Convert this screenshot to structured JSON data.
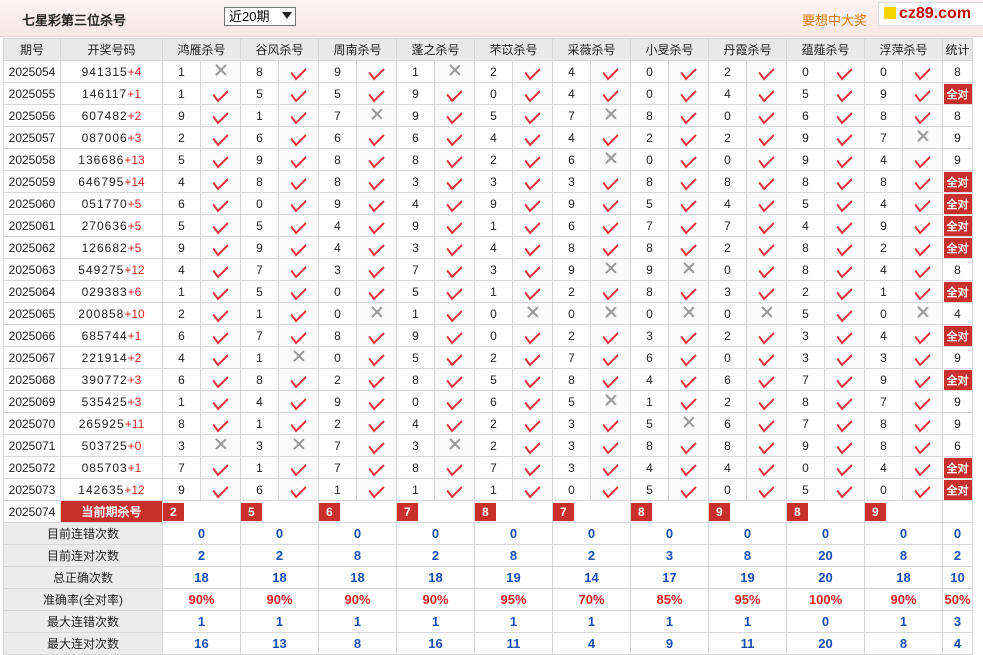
{
  "header": {
    "title": "七星彩第三位杀号",
    "period_select": "近20期",
    "promo": "要想中大奖",
    "logo": "cz89.com"
  },
  "columns": [
    "期号",
    "开奖号码",
    "鸿雁杀号",
    "谷风杀号",
    "周南杀号",
    "蓬之杀号",
    "芣苡杀号",
    "采薇杀号",
    "小旻杀号",
    "丹霞杀号",
    "蕴薤杀号",
    "浮萍杀号",
    "统计"
  ],
  "rows": [
    {
      "p": "2025054",
      "num": "941315",
      "d": "+4",
      "k": [
        [
          "1",
          0
        ],
        [
          "8",
          1
        ],
        [
          "9",
          1
        ],
        [
          "1",
          0
        ],
        [
          "2",
          1
        ],
        [
          "4",
          1
        ],
        [
          "0",
          1
        ],
        [
          "2",
          1
        ],
        [
          "0",
          1
        ],
        [
          "0",
          1
        ]
      ],
      "s": "8"
    },
    {
      "p": "2025055",
      "num": "146117",
      "d": "+1",
      "k": [
        [
          "1",
          1
        ],
        [
          "5",
          1
        ],
        [
          "5",
          1
        ],
        [
          "9",
          1
        ],
        [
          "0",
          1
        ],
        [
          "4",
          1
        ],
        [
          "0",
          1
        ],
        [
          "4",
          1
        ],
        [
          "5",
          1
        ],
        [
          "9",
          1
        ]
      ],
      "s": "全对"
    },
    {
      "p": "2025056",
      "num": "607482",
      "d": "+2",
      "k": [
        [
          "9",
          1
        ],
        [
          "1",
          1
        ],
        [
          "7",
          0
        ],
        [
          "9",
          1
        ],
        [
          "5",
          1
        ],
        [
          "7",
          0
        ],
        [
          "8",
          1
        ],
        [
          "0",
          1
        ],
        [
          "6",
          1
        ],
        [
          "8",
          1
        ]
      ],
      "s": "8"
    },
    {
      "p": "2025057",
      "num": "087006",
      "d": "+3",
      "k": [
        [
          "2",
          1
        ],
        [
          "6",
          1
        ],
        [
          "6",
          1
        ],
        [
          "6",
          1
        ],
        [
          "4",
          1
        ],
        [
          "4",
          1
        ],
        [
          "2",
          1
        ],
        [
          "2",
          1
        ],
        [
          "9",
          1
        ],
        [
          "7",
          0
        ]
      ],
      "s": "9"
    },
    {
      "p": "2025058",
      "num": "136686",
      "d": "+13",
      "k": [
        [
          "5",
          1
        ],
        [
          "9",
          1
        ],
        [
          "8",
          1
        ],
        [
          "8",
          1
        ],
        [
          "2",
          1
        ],
        [
          "6",
          0
        ],
        [
          "0",
          1
        ],
        [
          "0",
          1
        ],
        [
          "9",
          1
        ],
        [
          "4",
          1
        ]
      ],
      "s": "9"
    },
    {
      "p": "2025059",
      "num": "646795",
      "d": "+14",
      "k": [
        [
          "4",
          1
        ],
        [
          "8",
          1
        ],
        [
          "8",
          1
        ],
        [
          "3",
          1
        ],
        [
          "3",
          1
        ],
        [
          "3",
          1
        ],
        [
          "8",
          1
        ],
        [
          "8",
          1
        ],
        [
          "8",
          1
        ],
        [
          "8",
          1
        ]
      ],
      "s": "全对"
    },
    {
      "p": "2025060",
      "num": "051770",
      "d": "+5",
      "k": [
        [
          "6",
          1
        ],
        [
          "0",
          1
        ],
        [
          "9",
          1
        ],
        [
          "4",
          1
        ],
        [
          "9",
          1
        ],
        [
          "9",
          1
        ],
        [
          "5",
          1
        ],
        [
          "4",
          1
        ],
        [
          "5",
          1
        ],
        [
          "4",
          1
        ]
      ],
      "s": "全对"
    },
    {
      "p": "2025061",
      "num": "270636",
      "d": "+5",
      "k": [
        [
          "5",
          1
        ],
        [
          "5",
          1
        ],
        [
          "4",
          1
        ],
        [
          "9",
          1
        ],
        [
          "1",
          1
        ],
        [
          "6",
          1
        ],
        [
          "7",
          1
        ],
        [
          "7",
          1
        ],
        [
          "4",
          1
        ],
        [
          "9",
          1
        ]
      ],
      "s": "全对"
    },
    {
      "p": "2025062",
      "num": "126682",
      "d": "+5",
      "k": [
        [
          "9",
          1
        ],
        [
          "9",
          1
        ],
        [
          "4",
          1
        ],
        [
          "3",
          1
        ],
        [
          "4",
          1
        ],
        [
          "8",
          1
        ],
        [
          "8",
          1
        ],
        [
          "2",
          1
        ],
        [
          "8",
          1
        ],
        [
          "2",
          1
        ]
      ],
      "s": "全对"
    },
    {
      "p": "2025063",
      "num": "549275",
      "d": "+12",
      "k": [
        [
          "4",
          1
        ],
        [
          "7",
          1
        ],
        [
          "3",
          1
        ],
        [
          "7",
          1
        ],
        [
          "3",
          1
        ],
        [
          "9",
          0
        ],
        [
          "9",
          0
        ],
        [
          "0",
          1
        ],
        [
          "8",
          1
        ],
        [
          "4",
          1
        ]
      ],
      "s": "8"
    },
    {
      "p": "2025064",
      "num": "029383",
      "d": "+6",
      "k": [
        [
          "1",
          1
        ],
        [
          "5",
          1
        ],
        [
          "0",
          1
        ],
        [
          "5",
          1
        ],
        [
          "1",
          1
        ],
        [
          "2",
          1
        ],
        [
          "8",
          1
        ],
        [
          "3",
          1
        ],
        [
          "2",
          1
        ],
        [
          "1",
          1
        ]
      ],
      "s": "全对"
    },
    {
      "p": "2025065",
      "num": "200858",
      "d": "+10",
      "k": [
        [
          "2",
          1
        ],
        [
          "1",
          1
        ],
        [
          "0",
          0
        ],
        [
          "1",
          1
        ],
        [
          "0",
          0
        ],
        [
          "0",
          0
        ],
        [
          "0",
          0
        ],
        [
          "0",
          0
        ],
        [
          "5",
          1
        ],
        [
          "0",
          0
        ]
      ],
      "s": "4"
    },
    {
      "p": "2025066",
      "num": "685744",
      "d": "+1",
      "k": [
        [
          "6",
          1
        ],
        [
          "7",
          1
        ],
        [
          "8",
          1
        ],
        [
          "9",
          1
        ],
        [
          "0",
          1
        ],
        [
          "2",
          1
        ],
        [
          "3",
          1
        ],
        [
          "2",
          1
        ],
        [
          "3",
          1
        ],
        [
          "4",
          1
        ]
      ],
      "s": "全对"
    },
    {
      "p": "2025067",
      "num": "221914",
      "d": "+2",
      "k": [
        [
          "4",
          1
        ],
        [
          "1",
          0
        ],
        [
          "0",
          1
        ],
        [
          "5",
          1
        ],
        [
          "2",
          1
        ],
        [
          "7",
          1
        ],
        [
          "6",
          1
        ],
        [
          "0",
          1
        ],
        [
          "3",
          1
        ],
        [
          "3",
          1
        ]
      ],
      "s": "9"
    },
    {
      "p": "2025068",
      "num": "390772",
      "d": "+3",
      "k": [
        [
          "6",
          1
        ],
        [
          "8",
          1
        ],
        [
          "2",
          1
        ],
        [
          "8",
          1
        ],
        [
          "5",
          1
        ],
        [
          "8",
          1
        ],
        [
          "4",
          1
        ],
        [
          "6",
          1
        ],
        [
          "7",
          1
        ],
        [
          "9",
          1
        ]
      ],
      "s": "全对"
    },
    {
      "p": "2025069",
      "num": "535425",
      "d": "+3",
      "k": [
        [
          "1",
          1
        ],
        [
          "4",
          1
        ],
        [
          "9",
          1
        ],
        [
          "0",
          1
        ],
        [
          "6",
          1
        ],
        [
          "5",
          0
        ],
        [
          "1",
          1
        ],
        [
          "2",
          1
        ],
        [
          "8",
          1
        ],
        [
          "7",
          1
        ]
      ],
      "s": "9"
    },
    {
      "p": "2025070",
      "num": "265925",
      "d": "+11",
      "k": [
        [
          "8",
          1
        ],
        [
          "1",
          1
        ],
        [
          "2",
          1
        ],
        [
          "4",
          1
        ],
        [
          "2",
          1
        ],
        [
          "3",
          1
        ],
        [
          "5",
          0
        ],
        [
          "6",
          1
        ],
        [
          "7",
          1
        ],
        [
          "8",
          1
        ]
      ],
      "s": "9"
    },
    {
      "p": "2025071",
      "num": "503725",
      "d": "+0",
      "k": [
        [
          "3",
          0
        ],
        [
          "3",
          0
        ],
        [
          "7",
          1
        ],
        [
          "3",
          0
        ],
        [
          "2",
          1
        ],
        [
          "3",
          1
        ],
        [
          "8",
          1
        ],
        [
          "8",
          1
        ],
        [
          "9",
          1
        ],
        [
          "8",
          1
        ]
      ],
      "s": "6"
    },
    {
      "p": "2025072",
      "num": "085703",
      "d": "+1",
      "k": [
        [
          "7",
          1
        ],
        [
          "1",
          1
        ],
        [
          "7",
          1
        ],
        [
          "8",
          1
        ],
        [
          "7",
          1
        ],
        [
          "3",
          1
        ],
        [
          "4",
          1
        ],
        [
          "4",
          1
        ],
        [
          "0",
          1
        ],
        [
          "4",
          1
        ]
      ],
      "s": "全对"
    },
    {
      "p": "2025073",
      "num": "142635",
      "d": "+12",
      "k": [
        [
          "9",
          1
        ],
        [
          "6",
          1
        ],
        [
          "1",
          1
        ],
        [
          "1",
          1
        ],
        [
          "1",
          1
        ],
        [
          "0",
          1
        ],
        [
          "5",
          1
        ],
        [
          "0",
          1
        ],
        [
          "5",
          1
        ],
        [
          "0",
          1
        ]
      ],
      "s": "全对"
    }
  ],
  "current": {
    "p": "2025074",
    "label": "当前期杀号",
    "k": [
      "2",
      "5",
      "6",
      "7",
      "8",
      "7",
      "8",
      "9",
      "8",
      "9"
    ]
  },
  "stats": [
    {
      "label": "目前连错次数",
      "v": [
        "0",
        "0",
        "0",
        "0",
        "0",
        "0",
        "0",
        "0",
        "0",
        "0",
        "0"
      ]
    },
    {
      "label": "目前连对次数",
      "v": [
        "2",
        "2",
        "8",
        "2",
        "8",
        "2",
        "3",
        "8",
        "20",
        "8",
        "2"
      ]
    },
    {
      "label": "总正确次数",
      "v": [
        "18",
        "18",
        "18",
        "18",
        "19",
        "14",
        "17",
        "19",
        "20",
        "18",
        "10"
      ]
    },
    {
      "label": "准确率(全对率)",
      "v": [
        "90%",
        "90%",
        "90%",
        "90%",
        "95%",
        "70%",
        "85%",
        "95%",
        "100%",
        "90%",
        "50%"
      ],
      "rate": true
    },
    {
      "label": "最大连错次数",
      "v": [
        "1",
        "1",
        "1",
        "1",
        "1",
        "1",
        "1",
        "1",
        "0",
        "1",
        "3"
      ]
    },
    {
      "label": "最大连对次数",
      "v": [
        "16",
        "13",
        "8",
        "16",
        "11",
        "4",
        "9",
        "11",
        "20",
        "8",
        "4"
      ]
    }
  ]
}
